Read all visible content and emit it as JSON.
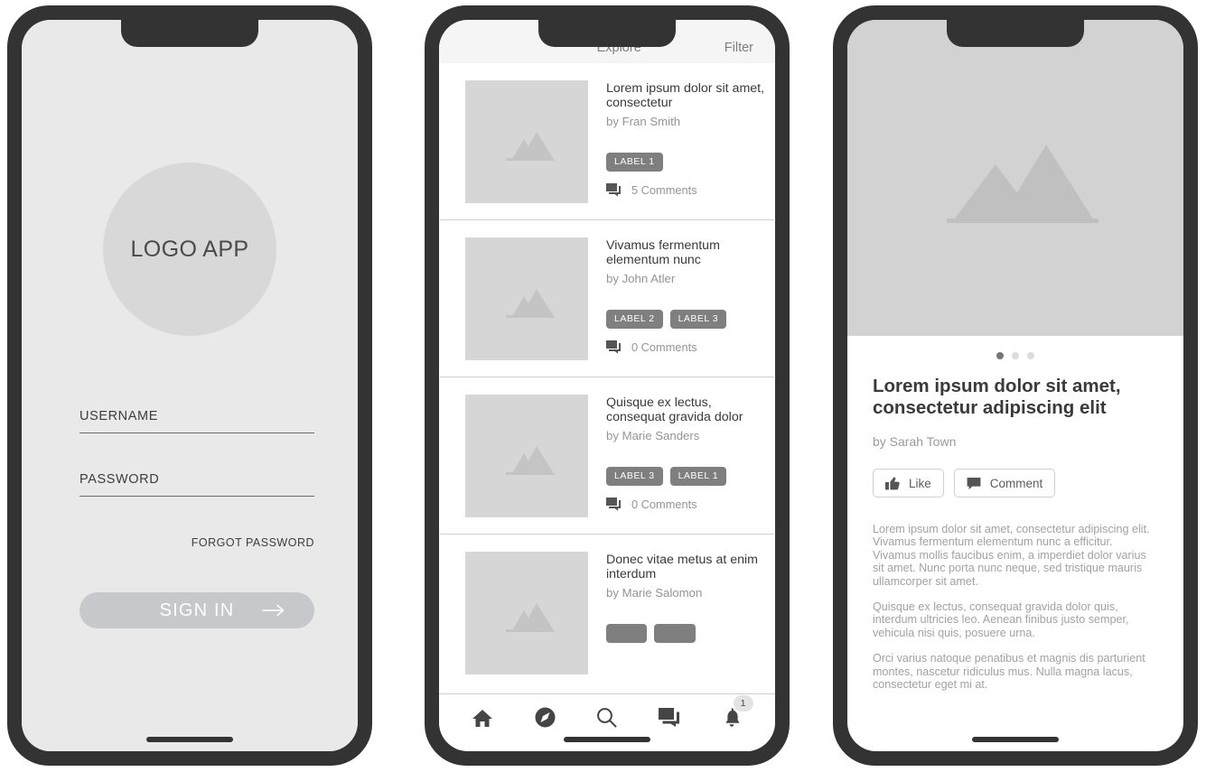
{
  "colors": {
    "frame": "#333333",
    "login_bg": "#e9e9e9",
    "logo_circle": "#d8d8d8",
    "signin_button": "#c6c8cb",
    "chip": "#7f7f7f",
    "placeholder_image": "#d6d6d6",
    "hero_image": "#d2d2d2",
    "header_bar": "#f5f5f5",
    "divider": "#cfcfcf",
    "muted_text": "#949494",
    "body_text": "#3a3a3a"
  },
  "login": {
    "logo_text": "LOGO APP",
    "logo_icon": "logo-circle",
    "username": {
      "label": "USERNAME",
      "value": ""
    },
    "password": {
      "label": "PASSWORD",
      "value": ""
    },
    "forgot_password": "FORGOT PASSWORD",
    "sign_in": {
      "label": "SIGN IN",
      "arrow_icon": "arrow-right-icon"
    }
  },
  "feed": {
    "header": {
      "explore": "Explore",
      "filter": "Filter"
    },
    "items": [
      {
        "title": "Lorem ipsum dolor sit amet, consectetur",
        "author": "by Fran Smith",
        "labels": [
          "LABEL 1"
        ],
        "comments": "5 Comments",
        "thumbnail_icon": "image-placeholder-icon"
      },
      {
        "title": "Vivamus fermentum elementum nunc",
        "author": "by John Atler",
        "labels": [
          "LABEL 2",
          "LABEL 3"
        ],
        "comments": "0 Comments",
        "thumbnail_icon": "image-placeholder-icon"
      },
      {
        "title": "Quisque ex lectus, consequat gravida dolor",
        "author": "by Marie Sanders",
        "labels": [
          "LABEL 3",
          "LABEL 1"
        ],
        "comments": "0 Comments",
        "thumbnail_icon": "image-placeholder-icon"
      },
      {
        "title": "Donec vitae metus at enim interdum",
        "author": "by Marie Salomon",
        "labels": [
          "",
          ""
        ],
        "comments": "",
        "thumbnail_icon": "image-placeholder-icon"
      }
    ],
    "nav": [
      {
        "icon": "home-icon",
        "badge": ""
      },
      {
        "icon": "compass-icon",
        "badge": ""
      },
      {
        "icon": "search-icon",
        "badge": ""
      },
      {
        "icon": "forum-icon",
        "badge": ""
      },
      {
        "icon": "bell-icon",
        "badge": "1"
      }
    ]
  },
  "article": {
    "hero_icon": "image-placeholder-icon",
    "carousel": {
      "total": 3,
      "active_index": 0
    },
    "title": "Lorem ipsum dolor sit amet, consectetur adipiscing elit",
    "author": "by Sarah Town",
    "actions": [
      {
        "label": "Like",
        "icon": "thumbs-up-icon"
      },
      {
        "label": "Comment",
        "icon": "comment-icon"
      }
    ],
    "paragraphs": [
      "Lorem ipsum dolor sit amet, consectetur adipiscing elit. Vivamus fermentum elementum nunc a efficitur. Vivamus mollis faucibus enim, a imperdiet dolor varius sit amet. Nunc porta nunc neque, sed tristique mauris ullamcorper sit amet.",
      "Quisque ex lectus, consequat gravida dolor quis, interdum ultricies leo. Aenean finibus justo semper, vehicula nisi quis, posuere urna.",
      "Orci varius natoque penatibus et magnis dis parturient montes, nascetur ridiculus mus. Nulla magna lacus, consectetur eget mi at."
    ]
  }
}
